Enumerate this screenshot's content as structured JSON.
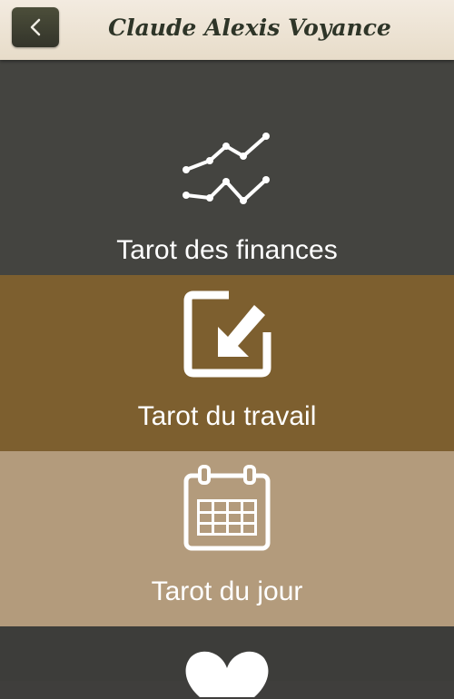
{
  "header": {
    "title": "Claude Alexis Voyance",
    "back_icon": "chevron-left-icon"
  },
  "menu": [
    {
      "label": "Tarot des finances",
      "icon": "trend-lines-icon",
      "bg": "#444440"
    },
    {
      "label": "Tarot du travail",
      "icon": "arrow-into-box-icon",
      "bg": "#7d5f2f"
    },
    {
      "label": "Tarot du jour",
      "icon": "calendar-icon",
      "bg": "#b39b7c"
    },
    {
      "label": "",
      "icon": "heart-icon",
      "bg": "#3d3d3a"
    }
  ]
}
